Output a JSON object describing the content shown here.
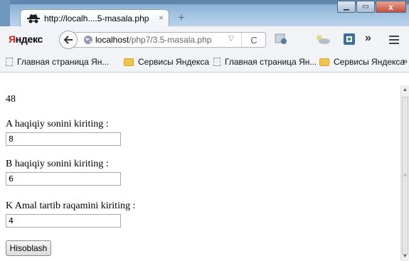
{
  "tab": {
    "title": "http://localh....5-masala.php",
    "close_glyph": "×",
    "new_tab_glyph": "+"
  },
  "window_buttons": {
    "minimize": "▁",
    "maximize": "▭",
    "close": "x"
  },
  "navbar": {
    "brand_first": "Я",
    "brand_rest": "ндекс",
    "url_host": "localhost",
    "url_path": "/php7/3.5-masala.php",
    "dropdown_glyph": "▽",
    "reload_glyph": "C",
    "more_glyph": "»"
  },
  "bookmarks": [
    {
      "label": "Главная страница Ян...",
      "icon": "page-icon"
    },
    {
      "label": "Сервисы Яндекса",
      "icon": "folder-icon"
    },
    {
      "label": "Главная страница Ян...",
      "icon": "page-icon"
    },
    {
      "label": "Сервисы Яндекса",
      "icon": "folder-icon"
    }
  ],
  "bookmarks_more": "»",
  "page": {
    "result": "48",
    "a_label": "A haqiqiy sonini kiriting :",
    "a_value": "8",
    "b_label": "B haqiqiy sonini kiriting :",
    "b_value": "6",
    "k_label": "K Amal tartib raqamini kiriting :",
    "k_value": "4",
    "submit_label": "Hisoblash"
  },
  "colors": {
    "brand_red": "#e31b1b",
    "titlebar": "#a6c6e3"
  }
}
